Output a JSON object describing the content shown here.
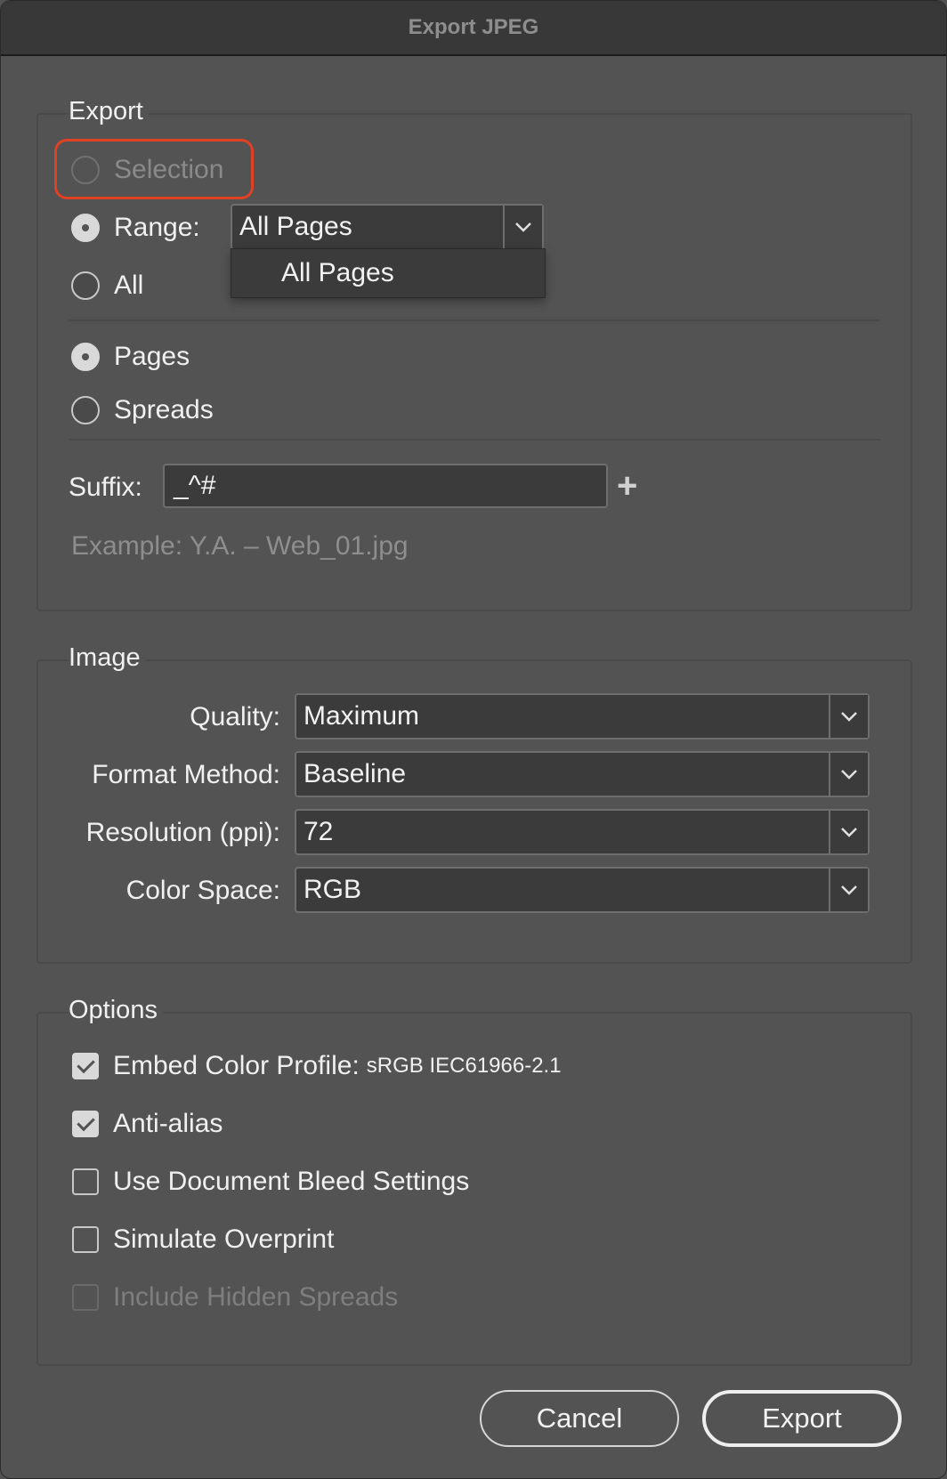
{
  "window": {
    "title": "Export JPEG"
  },
  "export": {
    "group_title": "Export",
    "selection_label": "Selection",
    "range_label": "Range:",
    "range_value": "All Pages",
    "range_dropdown_option": "All Pages",
    "all_label": "All",
    "pages_label": "Pages",
    "spreads_label": "Spreads",
    "suffix_label": "Suffix:",
    "suffix_value": "_^#",
    "example_text": "Example: Y.A. – Web_01.jpg"
  },
  "image": {
    "group_title": "Image",
    "quality_label": "Quality:",
    "quality_value": "Maximum",
    "format_label": "Format Method:",
    "format_value": "Baseline",
    "resolution_label": "Resolution (ppi):",
    "resolution_value": "72",
    "colorspace_label": "Color Space:",
    "colorspace_value": "RGB"
  },
  "options": {
    "group_title": "Options",
    "embed_label": "Embed Color Profile:",
    "embed_profile": "sRGB IEC61966-2.1",
    "embed_checked": true,
    "antialias_label": "Anti-alias",
    "antialias_checked": true,
    "bleed_label": "Use Document Bleed Settings",
    "bleed_checked": false,
    "overprint_label": "Simulate Overprint",
    "overprint_checked": false,
    "hidden_label": "Include Hidden Spreads",
    "hidden_checked": false
  },
  "buttons": {
    "cancel": "Cancel",
    "export": "Export"
  },
  "colors": {
    "highlight": "#e04124",
    "background": "#535353"
  }
}
